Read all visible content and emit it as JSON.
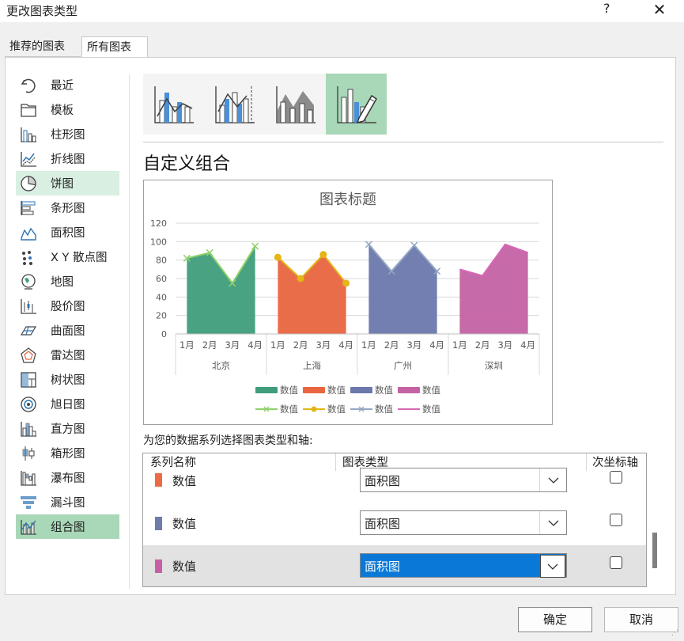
{
  "dialog": {
    "title": "更改图表类型",
    "help": "?",
    "close": "✕"
  },
  "tabs": [
    {
      "label": "推荐的图表"
    },
    {
      "label": "所有图表"
    }
  ],
  "left_list": [
    {
      "label": "最近",
      "icon": "undo-icon"
    },
    {
      "label": "模板",
      "icon": "folder-icon"
    },
    {
      "label": "柱形图",
      "icon": "column-chart-icon"
    },
    {
      "label": "折线图",
      "icon": "line-chart-icon"
    },
    {
      "label": "饼图",
      "icon": "pie-chart-icon"
    },
    {
      "label": "条形图",
      "icon": "bar-chart-icon"
    },
    {
      "label": "面积图",
      "icon": "area-chart-icon"
    },
    {
      "label": "X Y 散点图",
      "icon": "scatter-chart-icon"
    },
    {
      "label": "地图",
      "icon": "map-chart-icon"
    },
    {
      "label": "股价图",
      "icon": "stock-chart-icon"
    },
    {
      "label": "曲面图",
      "icon": "surface-chart-icon"
    },
    {
      "label": "雷达图",
      "icon": "radar-chart-icon"
    },
    {
      "label": "树状图",
      "icon": "treemap-chart-icon"
    },
    {
      "label": "旭日图",
      "icon": "sunburst-chart-icon"
    },
    {
      "label": "直方图",
      "icon": "histogram-chart-icon"
    },
    {
      "label": "箱形图",
      "icon": "boxwhisker-chart-icon"
    },
    {
      "label": "瀑布图",
      "icon": "waterfall-chart-icon"
    },
    {
      "label": "漏斗图",
      "icon": "funnel-chart-icon"
    },
    {
      "label": "组合图",
      "icon": "combo-chart-icon"
    }
  ],
  "section_heading": "自定义组合",
  "instruction": "为您的数据系列选择图表类型和轴:",
  "series_table": {
    "headers": {
      "name": "系列名称",
      "type": "图表类型",
      "secondary": "次坐标轴"
    },
    "rows": [
      {
        "name": "数值",
        "color": "#ec6b45",
        "type": "面积图",
        "secondary": false
      },
      {
        "name": "数值",
        "color": "#6f7bab",
        "type": "面积图",
        "secondary": false
      },
      {
        "name": "数值",
        "color": "#c85fa6",
        "type": "面积图",
        "secondary": false
      }
    ]
  },
  "buttons": {
    "ok": "确定",
    "cancel": "取消"
  },
  "chart_data": {
    "type": "area",
    "title": "图表标题",
    "ylim": [
      0,
      120
    ],
    "yticks": [
      0,
      20,
      40,
      60,
      80,
      100,
      120
    ],
    "grid": true,
    "legend_position": "bottom",
    "groups": [
      "北京",
      "上海",
      "广州",
      "深圳"
    ],
    "months": [
      "1月",
      "2月",
      "3月",
      "4月"
    ],
    "colors": [
      "#3f9d7b",
      "#e8653f",
      "#6c78ac",
      "#c462a4"
    ],
    "line_colors": [
      "#8fd16a",
      "#e3b516",
      "#93a7c4",
      "#d767b4"
    ],
    "series": [
      {
        "name": "数值",
        "group": "北京",
        "values": [
          82,
          88,
          55,
          95
        ]
      },
      {
        "name": "数值",
        "group": "上海",
        "values": [
          83,
          60,
          86,
          55
        ]
      },
      {
        "name": "数值",
        "group": "广州",
        "values": [
          97,
          68,
          96,
          68
        ]
      },
      {
        "name": "数值",
        "group": "深圳",
        "values": [
          70,
          63,
          97,
          88
        ]
      }
    ],
    "legend_label": "数值"
  }
}
